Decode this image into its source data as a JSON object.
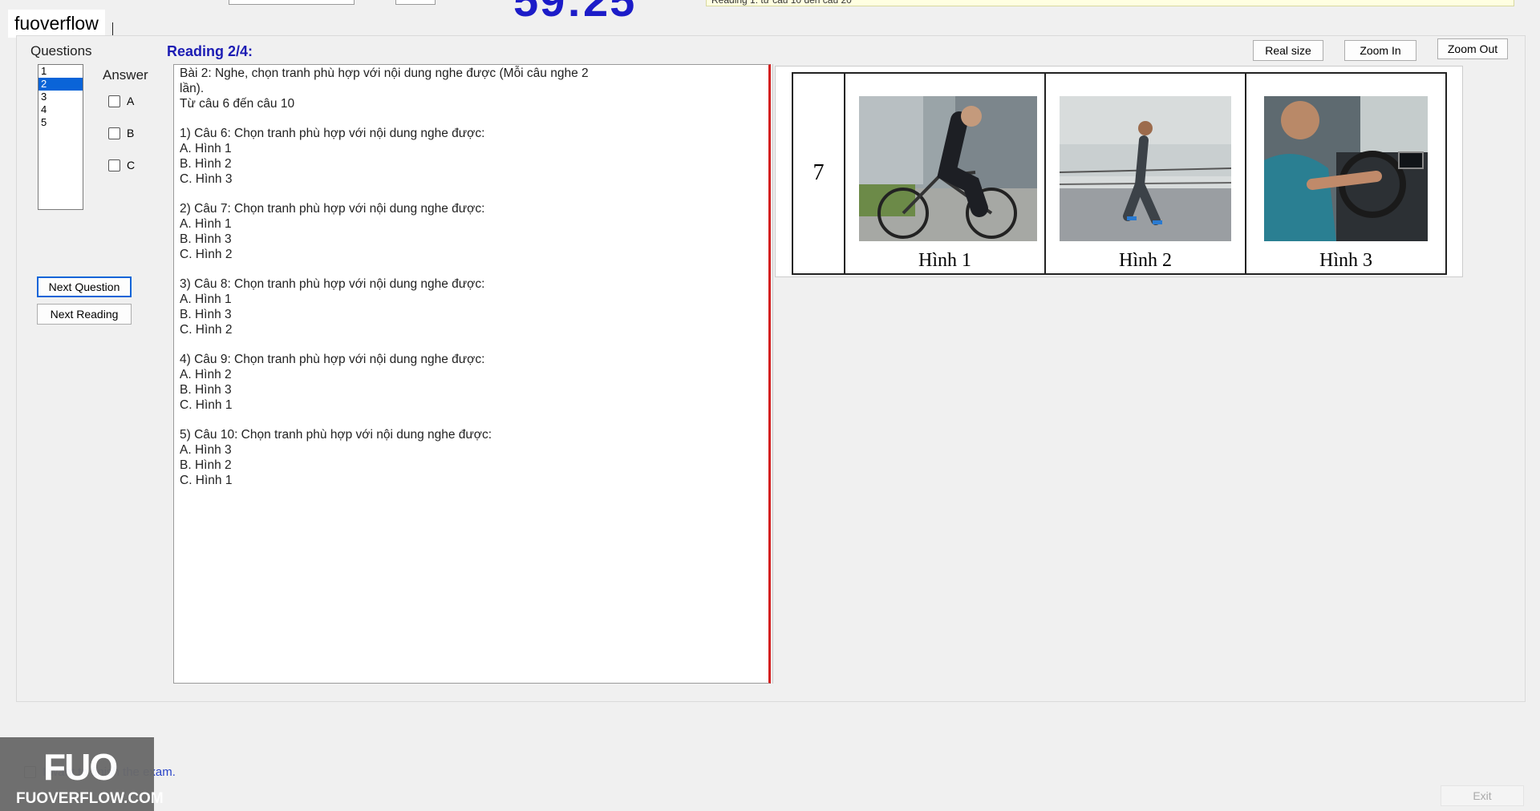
{
  "header": {
    "timer": "59:25",
    "notice": "Reading 1: từ câu 10 đến câu 20"
  },
  "watermark": {
    "site_label": "fuoverflow",
    "logo_text": "FUO",
    "logo_subtext": "FUOVERFLOW.COM"
  },
  "sidebar": {
    "questions_label": "Questions",
    "answer_label": "Answer",
    "questions": [
      "1",
      "2",
      "3",
      "4",
      "5"
    ],
    "selected_question": "2",
    "options": [
      "A",
      "B",
      "C"
    ],
    "next_question": "Next Question",
    "next_reading": "Next Reading"
  },
  "reading": {
    "title": "Reading 2/4:",
    "lines": [
      "Bài 2: Nghe, chọn tranh phù hợp với nội dung nghe được (Mỗi câu nghe 2",
      "lần).",
      "Từ câu 6 đến câu 10",
      "",
      "1) Câu 6: Chọn tranh phù hợp với nội dung nghe được:",
      "A.  Hình 1",
      "B.  Hình 2",
      "C.  Hình 3",
      "",
      "2) Câu 7: Chọn tranh phù hợp với nội dung nghe được:",
      "A.  Hình 1",
      "B.  Hình 3",
      "C.  Hình 2",
      "",
      "3) Câu 8: Chọn tranh phù hợp với nội dung nghe được:",
      "A.  Hình 1",
      "B.  Hình 3",
      "C.  Hình 2",
      "",
      "4) Câu 9: Chọn tranh phù hợp với nội dung nghe được:",
      "A.  Hình 2",
      "B.  Hình 3",
      "C.  Hình 1",
      "",
      "5) Câu 10: Chọn tranh phù hợp với nội dung nghe được:",
      "A.  Hình 3",
      "B.  Hình 2",
      "C.  Hình 1"
    ]
  },
  "image_viewer": {
    "real_size": "Real size",
    "zoom_in": "Zoom In",
    "zoom_out": "Zoom Out",
    "question_number": "7",
    "captions": [
      "Hình 1",
      "Hình 2",
      "Hình 3"
    ]
  },
  "footer": {
    "finish_label": "I want to finish the exam.",
    "exit": "Exit"
  }
}
